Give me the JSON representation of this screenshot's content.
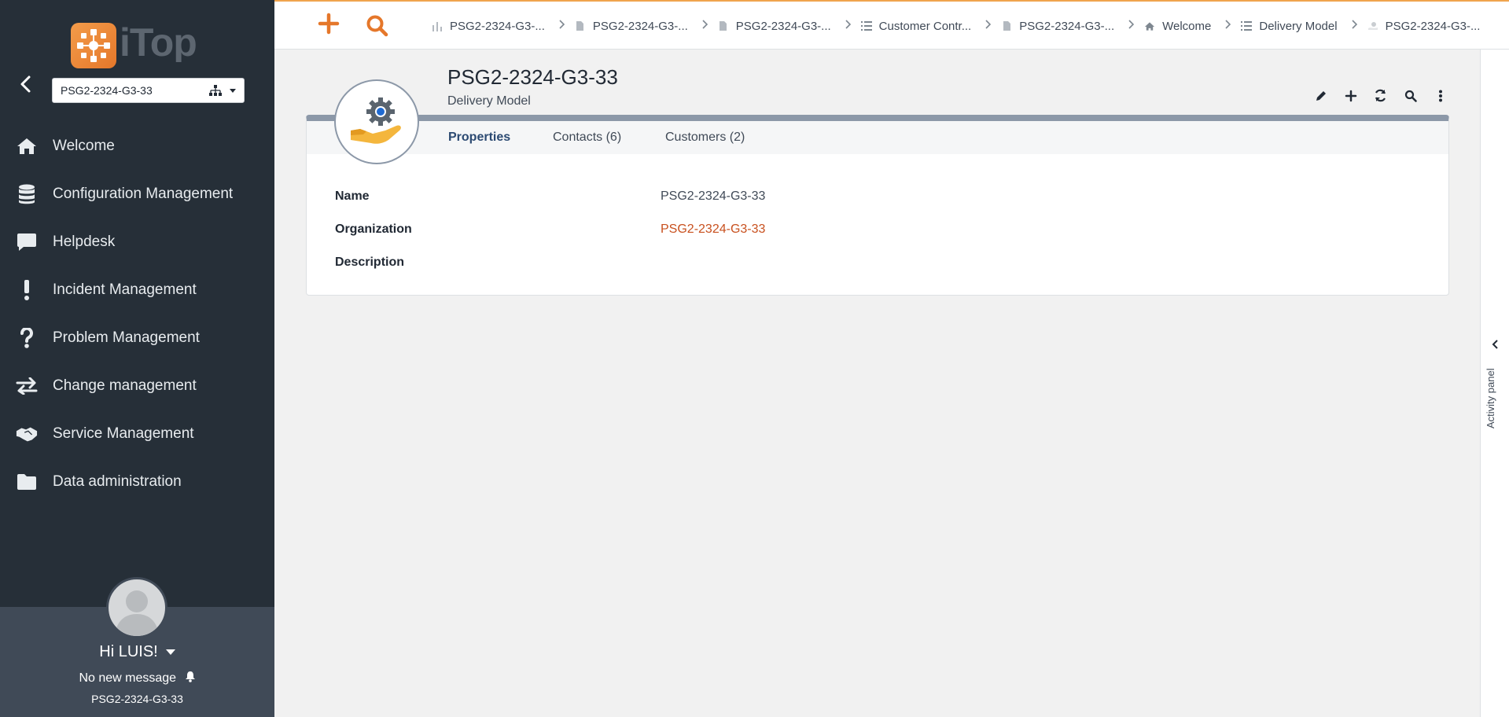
{
  "sidebar": {
    "org_selector": {
      "value": "PSG2-2324-G3-33"
    },
    "menu": [
      {
        "label": "Welcome",
        "icon": "home-icon"
      },
      {
        "label": "Configuration Management",
        "icon": "database-icon"
      },
      {
        "label": "Helpdesk",
        "icon": "chat-bubble-icon"
      },
      {
        "label": "Incident Management",
        "icon": "exclamation-icon"
      },
      {
        "label": "Problem Management",
        "icon": "question-icon"
      },
      {
        "label": "Change management",
        "icon": "exchange-arrows-icon"
      },
      {
        "label": "Service Management",
        "icon": "handshake-icon"
      },
      {
        "label": "Data administration",
        "icon": "folder-icon"
      }
    ],
    "user": {
      "greeting": "Hi LUIS!",
      "messages": "No new message",
      "organization": "PSG2-2324-G3-33"
    }
  },
  "topbar": {
    "breadcrumb": [
      {
        "label": "PSG2-2324-G3-...",
        "icon": "chart-icon"
      },
      {
        "label": "PSG2-2324-G3-...",
        "icon": "document-icon"
      },
      {
        "label": "PSG2-2324-G3-...",
        "icon": "document-icon"
      },
      {
        "label": "Customer Contr...",
        "icon": "list-icon"
      },
      {
        "label": "PSG2-2324-G3-...",
        "icon": "document-icon"
      },
      {
        "label": "Welcome",
        "icon": "home-icon"
      },
      {
        "label": "Delivery Model",
        "icon": "list-icon"
      },
      {
        "label": "PSG2-2324-G3-...",
        "icon": "delivery-model-icon"
      }
    ]
  },
  "object": {
    "title": "PSG2-2324-G3-33",
    "class": "Delivery Model",
    "tabs": [
      {
        "label": "Properties",
        "active": true
      },
      {
        "label": "Contacts (6)",
        "active": false
      },
      {
        "label": "Customers (2)",
        "active": false
      }
    ],
    "fields": [
      {
        "label": "Name",
        "value": "PSG2-2324-G3-33",
        "link": false
      },
      {
        "label": "Organization",
        "value": "PSG2-2324-G3-33",
        "link": true
      },
      {
        "label": "Description",
        "value": "",
        "link": false
      }
    ]
  },
  "activity_panel": {
    "label": "Activity panel"
  },
  "colors": {
    "accent": "#e5772a",
    "sidebar": "#262f38",
    "link": "#c8501e"
  }
}
